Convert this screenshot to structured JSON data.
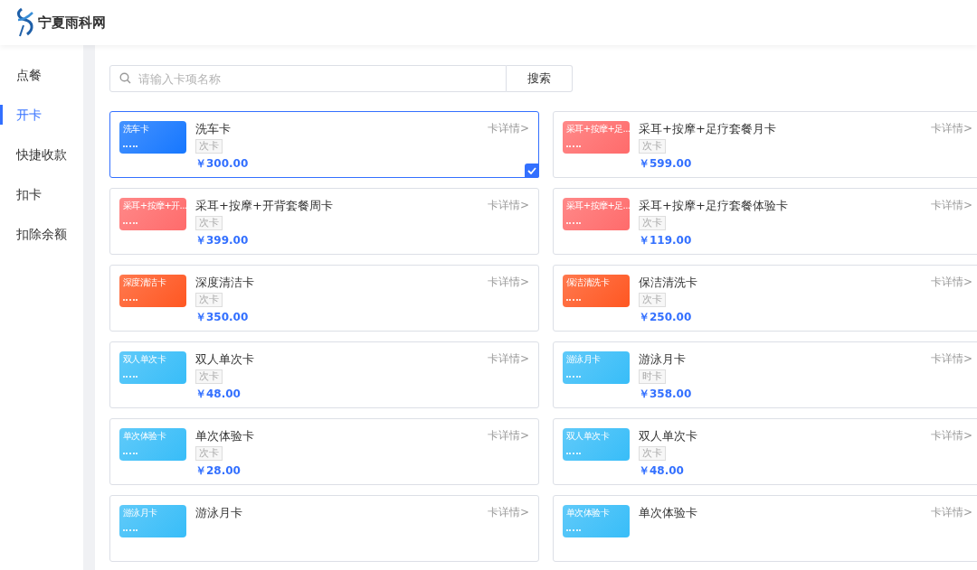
{
  "header": {
    "logo_text": "宁夏雨科网"
  },
  "sidebar": {
    "items": [
      {
        "label": "点餐",
        "selected": false
      },
      {
        "label": "开卡",
        "selected": true
      },
      {
        "label": "快捷收款",
        "selected": false
      },
      {
        "label": "扣卡",
        "selected": false
      },
      {
        "label": "扣除余额",
        "selected": false
      }
    ]
  },
  "search": {
    "placeholder": "请输入卡项名称",
    "button": "搜索"
  },
  "cards": [
    {
      "thumb_label": "洗车卡",
      "color": "#1677ff",
      "name": "洗车卡",
      "tag": "次卡",
      "price": "￥300.00",
      "detail": "卡详情>",
      "selected": true
    },
    {
      "thumb_label": "采耳+按摩+足...",
      "color": "#ff6b6b",
      "name": "采耳+按摩+足疗套餐月卡",
      "tag": "次卡",
      "price": "￥599.00",
      "detail": "卡详情>",
      "selected": false
    },
    {
      "thumb_label": "采耳+按摩+开...",
      "color": "#ff6b6b",
      "name": "采耳+按摩+开背套餐周卡",
      "tag": "次卡",
      "price": "￥399.00",
      "detail": "卡详情>",
      "selected": false
    },
    {
      "thumb_label": "采耳+按摩+足...",
      "color": "#ff6b6b",
      "name": "采耳+按摩+足疗套餐体验卡",
      "tag": "次卡",
      "price": "￥119.00",
      "detail": "卡详情>",
      "selected": false
    },
    {
      "thumb_label": "深度清洁卡",
      "color": "#ff5722",
      "name": "深度清洁卡",
      "tag": "次卡",
      "price": "￥350.00",
      "detail": "卡详情>",
      "selected": false
    },
    {
      "thumb_label": "保洁清洗卡",
      "color": "#ff5722",
      "name": "保洁清洗卡",
      "tag": "次卡",
      "price": "￥250.00",
      "detail": "卡详情>",
      "selected": false
    },
    {
      "thumb_label": "双人单次卡",
      "color": "#38bdf8",
      "name": "双人单次卡",
      "tag": "次卡",
      "price": "￥48.00",
      "detail": "卡详情>",
      "selected": false
    },
    {
      "thumb_label": "游泳月卡",
      "color": "#38bdf8",
      "name": "游泳月卡",
      "tag": "时卡",
      "price": "￥358.00",
      "detail": "卡详情>",
      "selected": false
    },
    {
      "thumb_label": "单次体验卡",
      "color": "#38bdf8",
      "name": "单次体验卡",
      "tag": "次卡",
      "price": "￥28.00",
      "detail": "卡详情>",
      "selected": false
    },
    {
      "thumb_label": "双人单次卡",
      "color": "#38bdf8",
      "name": "双人单次卡",
      "tag": "次卡",
      "price": "￥48.00",
      "detail": "卡详情>",
      "selected": false
    },
    {
      "thumb_label": "游泳月卡",
      "color": "#38bdf8",
      "name": "游泳月卡",
      "detail": "卡详情>",
      "selected": false
    },
    {
      "thumb_label": "单次体验卡",
      "color": "#38bdf8",
      "name": "单次体验卡",
      "detail": "卡详情>",
      "selected": false
    }
  ]
}
